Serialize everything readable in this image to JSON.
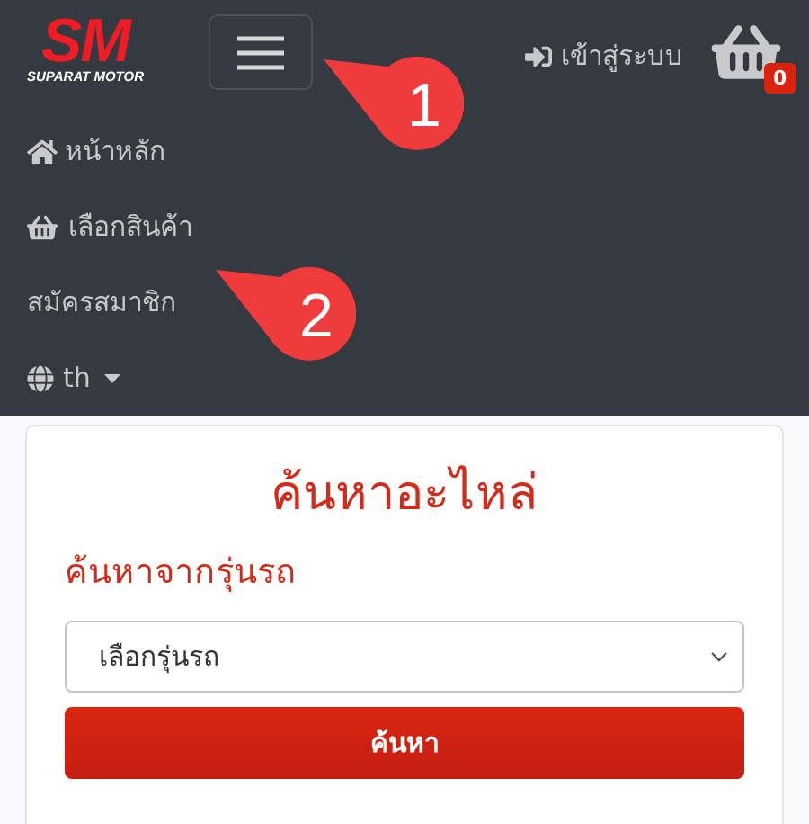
{
  "logo": {
    "mark": "SM",
    "name": "SUPARAT MOTOR"
  },
  "navbar": {
    "login": "เข้าสู่ระบบ",
    "cart_count": "0"
  },
  "menu": [
    {
      "kind": "home",
      "label": "หน้าหลัก"
    },
    {
      "kind": "shop",
      "label": "เลือกสินค้า"
    },
    {
      "kind": "plain",
      "label": "สมัครสมาชิก"
    },
    {
      "kind": "language",
      "label": "th"
    }
  ],
  "callouts": [
    {
      "number": "1"
    },
    {
      "number": "2"
    }
  ],
  "search_card": {
    "title": "ค้นหาอะไหล่",
    "subtitle": "ค้นหาจากรุ่นรถ",
    "select": {
      "value": "เลือกรุ่นรถ"
    },
    "button": "ค้นหา"
  }
}
